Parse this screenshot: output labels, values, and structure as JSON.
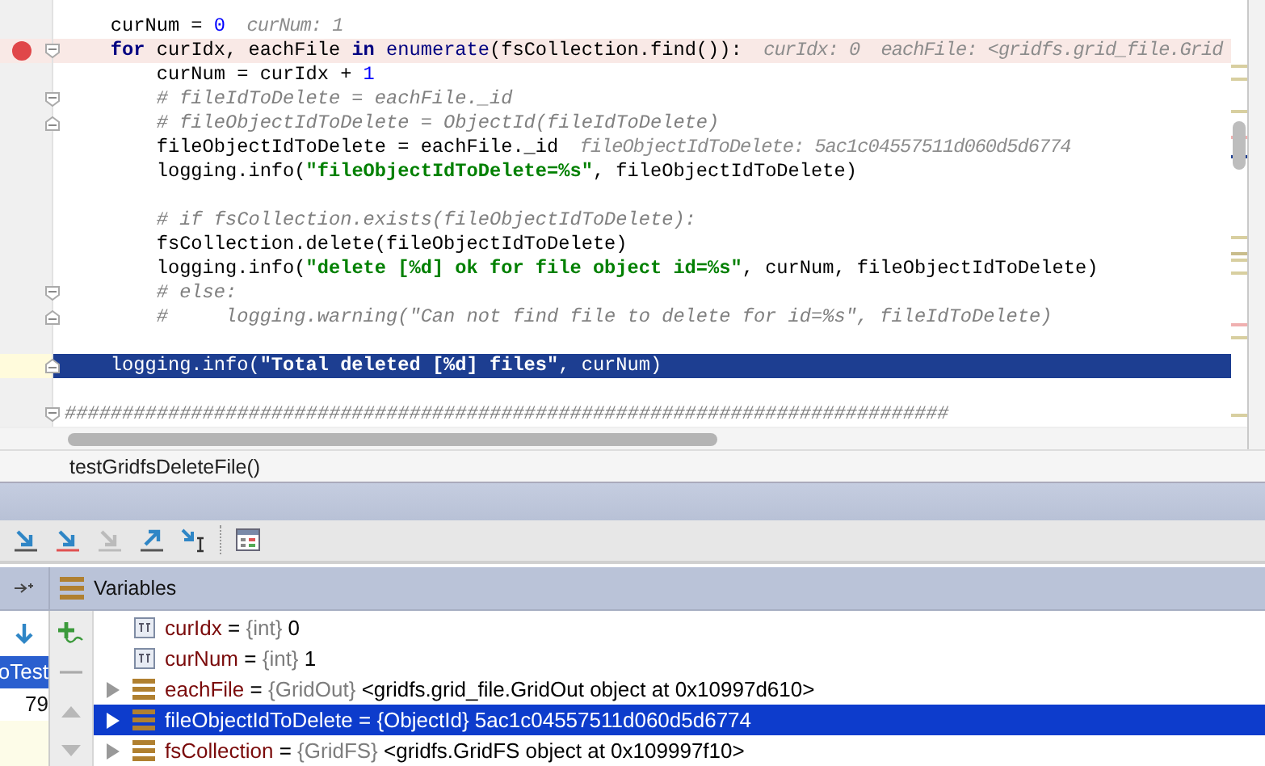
{
  "code_lines": [
    {
      "tokens": [
        {
          "kind": "plain",
          "text": "    curNum = "
        },
        {
          "kind": "number",
          "text": "0"
        },
        {
          "kind": "hint",
          "text": "  curNum: 1"
        }
      ],
      "breakpoint": false,
      "current": false
    },
    {
      "tokens": [
        {
          "kind": "keyword",
          "text": "    for"
        },
        {
          "kind": "plain",
          "text": " curIdx, eachFile "
        },
        {
          "kind": "keyword",
          "text": "in"
        },
        {
          "kind": "builtin",
          "text": " enumerate"
        },
        {
          "kind": "plain",
          "text": "(fsCollection.find()):"
        },
        {
          "kind": "hint",
          "text": "  curIdx: 0  eachFile: <gridfs.grid_file.Grid"
        }
      ],
      "breakpoint": true,
      "current": false,
      "fold_start": true
    },
    {
      "tokens": [
        {
          "kind": "plain",
          "text": "        curNum = curIdx + "
        },
        {
          "kind": "number",
          "text": "1"
        }
      ],
      "breakpoint": false,
      "current": false
    },
    {
      "tokens": [
        {
          "kind": "comment",
          "text": "        # fileIdToDelete = eachFile._id"
        }
      ],
      "breakpoint": false,
      "current": false,
      "fold_start": true
    },
    {
      "tokens": [
        {
          "kind": "comment",
          "text": "        # fileObjectIdToDelete = ObjectId(fileIdToDelete)"
        }
      ],
      "breakpoint": false,
      "current": false,
      "fold_end": true
    },
    {
      "tokens": [
        {
          "kind": "plain",
          "text": "        fileObjectIdToDelete = eachFile._id"
        },
        {
          "kind": "hint",
          "text": "  fileObjectIdToDelete: 5ac1c04557511d060d5d6774"
        }
      ],
      "breakpoint": false,
      "current": false
    },
    {
      "tokens": [
        {
          "kind": "plain",
          "text": "        logging.info("
        },
        {
          "kind": "string",
          "text": "\"fileObjectIdToDelete=%s\""
        },
        {
          "kind": "plain",
          "text": ", fileObjectIdToDelete)"
        }
      ],
      "breakpoint": false,
      "current": false
    },
    {
      "breakpoint": false,
      "current": false
    },
    {
      "tokens": [
        {
          "kind": "comment",
          "text": "        # if fsCollection.exists(fileObjectIdToDelete):"
        }
      ],
      "breakpoint": false,
      "current": false
    },
    {
      "tokens": [
        {
          "kind": "plain",
          "text": "        fsCollection.delete(fileObjectIdToDelete)"
        }
      ],
      "breakpoint": false,
      "current": false
    },
    {
      "tokens": [
        {
          "kind": "plain",
          "text": "        logging.info("
        },
        {
          "kind": "string",
          "text": "\"delete [%d] ok for file object id=%s\""
        },
        {
          "kind": "plain",
          "text": ", curNum, fileObjectIdToDelete)"
        }
      ],
      "breakpoint": false,
      "current": false
    },
    {
      "tokens": [
        {
          "kind": "comment",
          "text": "        # else:"
        }
      ],
      "breakpoint": false,
      "current": false,
      "fold_start": true
    },
    {
      "tokens": [
        {
          "kind": "comment",
          "text": "        #     logging.warning(\"Can not find file to delete for id=%s\", fileIdToDelete)"
        }
      ],
      "breakpoint": false,
      "current": false,
      "fold_end": true
    },
    {
      "breakpoint": false,
      "current": false
    },
    {
      "tokens": [
        {
          "kind": "plain",
          "text": "    logging.info("
        },
        {
          "kind": "string",
          "text": "\"Total deleted [%d] files\""
        },
        {
          "kind": "plain",
          "text": ", curNum)"
        }
      ],
      "breakpoint": false,
      "current": true,
      "fold_end": true
    },
    {
      "breakpoint": false,
      "current": false
    },
    {
      "tokens": [
        {
          "kind": "comment",
          "text": "#############################################################################"
        }
      ],
      "breakpoint": false,
      "current": false,
      "fold_start": true
    }
  ],
  "breadcrumb": "testGridfsDeleteFile()",
  "variables_panel": {
    "title": "Variables"
  },
  "frames": [
    {
      "label": "oTest",
      "selected": true
    },
    {
      "label": "79",
      "selected": false
    }
  ],
  "variables": [
    {
      "name": "curIdx",
      "operator": "=",
      "type": "{int}",
      "value": "0",
      "kind": "primitive",
      "expandable": false,
      "selected": false
    },
    {
      "name": "curNum",
      "operator": "=",
      "type": "{int}",
      "value": "1",
      "kind": "primitive",
      "expandable": false,
      "selected": false
    },
    {
      "name": "eachFile",
      "operator": "=",
      "type": "{GridOut}",
      "value": "<gridfs.grid_file.GridOut object at 0x10997d610>",
      "kind": "object",
      "expandable": true,
      "selected": false
    },
    {
      "name": "fileObjectIdToDelete",
      "operator": "=",
      "type": "{ObjectId}",
      "value": "5ac1c04557511d060d5d6774",
      "kind": "object",
      "expandable": true,
      "selected": true
    },
    {
      "name": "fsCollection",
      "operator": "=",
      "type": "{GridFS}",
      "value": "<gridfs.GridFS object at 0x109997f10>",
      "kind": "object",
      "expandable": true,
      "selected": false
    }
  ]
}
